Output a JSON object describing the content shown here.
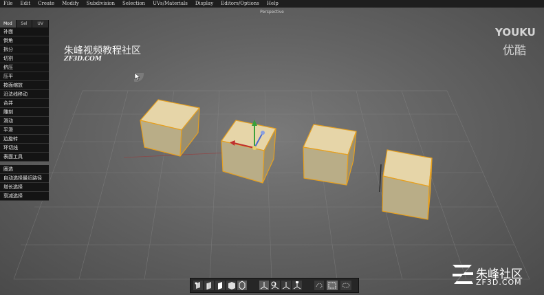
{
  "menubar": [
    "File",
    "Edit",
    "Create",
    "Modify",
    "Subdivision",
    "Selection",
    "UVs/Materials",
    "Display",
    "Editors/Options",
    "Help"
  ],
  "viewport_title": "Perspective",
  "panel": {
    "tabs": [
      "Mod",
      "Sel",
      "UV"
    ],
    "active_tab": "Mod",
    "tools_group1": [
      "补面",
      "倒角",
      "拆分",
      "切割",
      "挤压",
      "压平",
      "按面缩放",
      "沿法线移动",
      "合并",
      "雕刻",
      "滑动",
      "平滑",
      "边旋转",
      "环切线",
      "表面工具"
    ],
    "tools_group2": [
      "圈选",
      "自动选择最近路径",
      "增长选择",
      "衰减选择"
    ]
  },
  "watermark": {
    "title_cn": "朱峰视频教程社区",
    "site": "ZF3D.COM"
  },
  "youku": {
    "brand": "YOUKU",
    "brand_cn": "优酷"
  },
  "corner_logo": {
    "name_cn": "朱峰社区",
    "site": "ZF3D.COM"
  },
  "colors": {
    "cube_top": "#e6d5a8",
    "cube_left": "#b9ad87",
    "cube_right": "#9a8f70",
    "outline": "#e6a020",
    "menubar": "#1e1e1e",
    "panel_button": "#141414"
  },
  "toolbar_icons": [
    "vertex-mode-icon",
    "edge-mode-icon",
    "face-mode-icon",
    "object-mode-icon",
    "shaded-mode-icon",
    "move-tool-icon",
    "rotate-tool-icon",
    "scale-tool-icon",
    "universal-tool-icon",
    "lasso-select-icon",
    "box-select-icon",
    "paint-select-icon"
  ]
}
